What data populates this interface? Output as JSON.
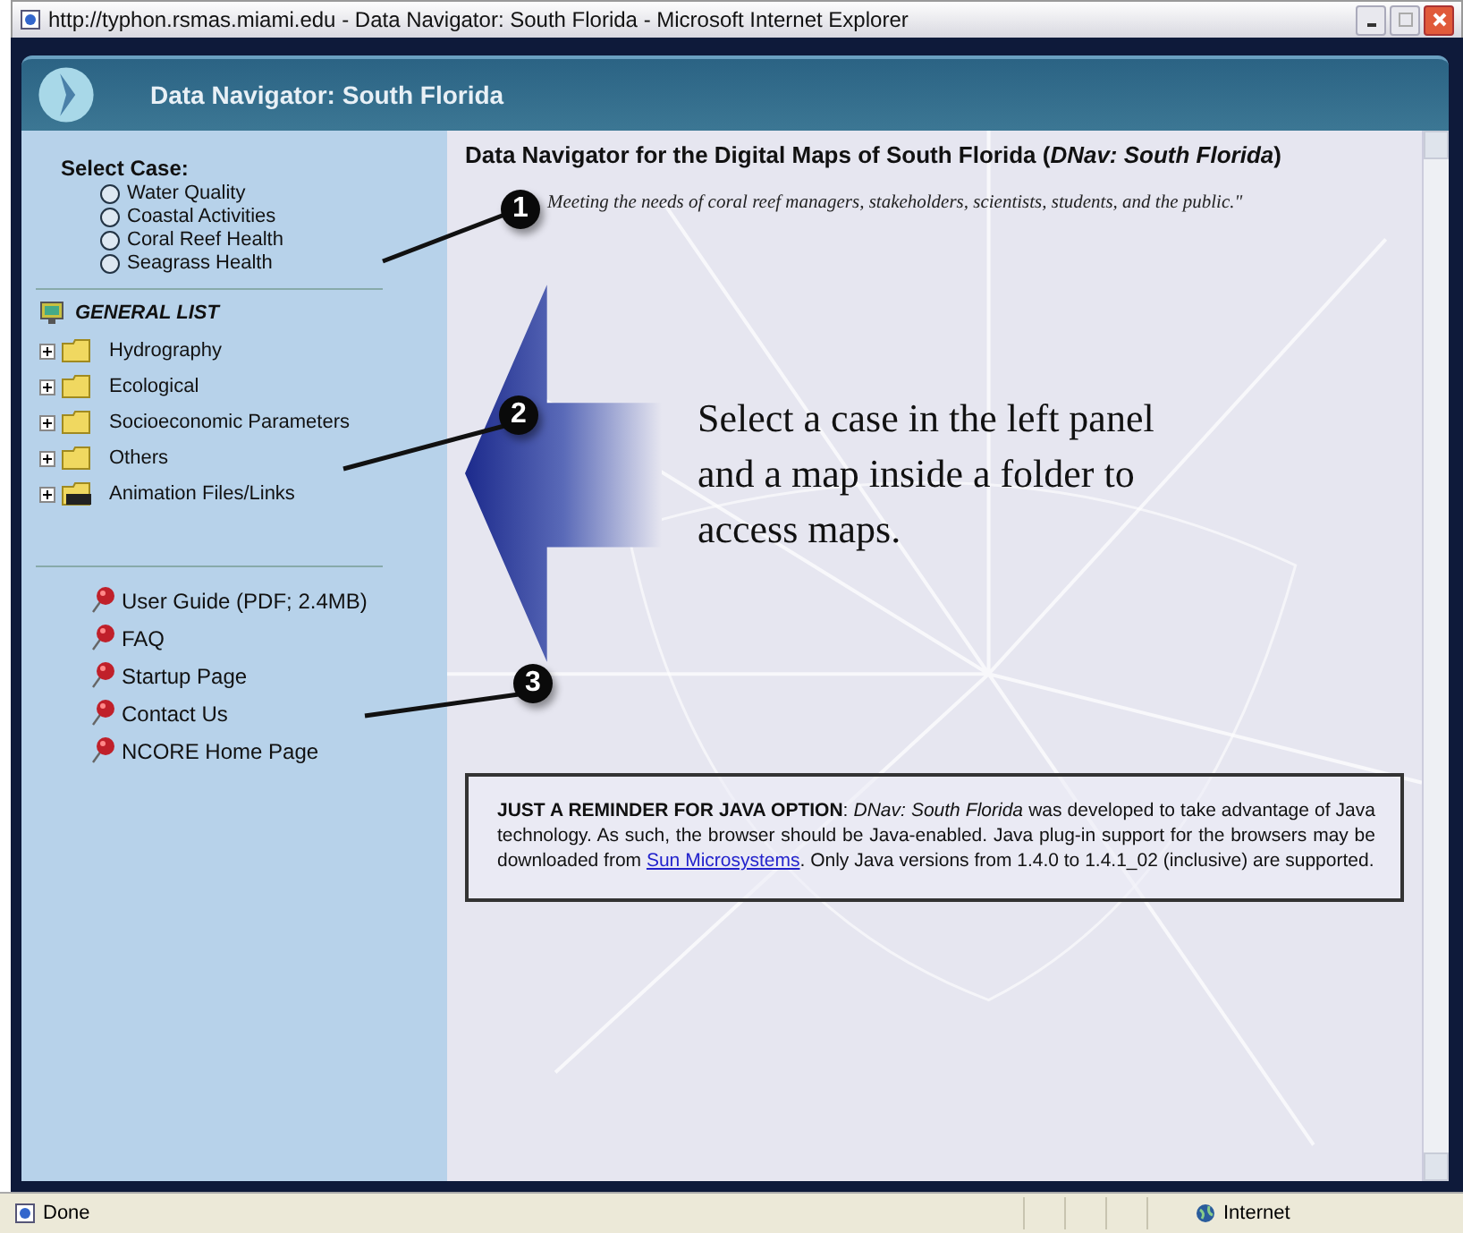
{
  "window": {
    "title": "http://typhon.rsmas.miami.edu - Data Navigator: South Florida - Microsoft Internet Explorer"
  },
  "header": {
    "title": "Data Navigator: South Florida"
  },
  "sidebar": {
    "case_heading": "Select Case:",
    "cases": [
      {
        "label": "Water Quality",
        "selected": false
      },
      {
        "label": "Coastal Activities",
        "selected": false
      },
      {
        "label": "Coral Reef Health",
        "selected": false
      },
      {
        "label": "Seagrass Health",
        "selected": false
      }
    ],
    "list_heading": "GENERAL LIST",
    "folders": [
      {
        "label": "Hydrography",
        "kind": "folder",
        "expanded": false
      },
      {
        "label": "Ecological",
        "kind": "folder",
        "expanded": false
      },
      {
        "label": "Socioeconomic Parameters",
        "kind": "folder",
        "expanded": false
      },
      {
        "label": "Others",
        "kind": "folder",
        "expanded": false
      },
      {
        "label": "Animation Files/Links",
        "kind": "animation",
        "expanded": false
      }
    ],
    "links": [
      "User Guide (PDF; 2.4MB)",
      "FAQ",
      "Startup Page",
      "Contact Us",
      "NCORE Home Page"
    ]
  },
  "main": {
    "heading": "Data Navigator for the Digital Maps of South Florida  (*DNav: South Florida*)",
    "quote": "Meeting the needs of coral reef managers, stakeholders, scientists, students, and the public.\"",
    "instruction": "Select a case in the left panel and a map inside a folder to access maps.",
    "reminder": {
      "before": "**JUST A REMINDER FOR JAVA OPTION**: *DNav: South Florida* was developed to take advantage of Java technology. As such, the browser should be Java-enabled. Java plug-in support for the browsers may be downloaded from ",
      "link": "Sun Microsystems",
      "after": ". Only Java versions from 1.4.0 to 1.4.1_02 (inclusive) are supported."
    }
  },
  "callouts": [
    "1",
    "2",
    "3"
  ],
  "status_bar": {
    "text": "Done",
    "zone": "Internet"
  }
}
